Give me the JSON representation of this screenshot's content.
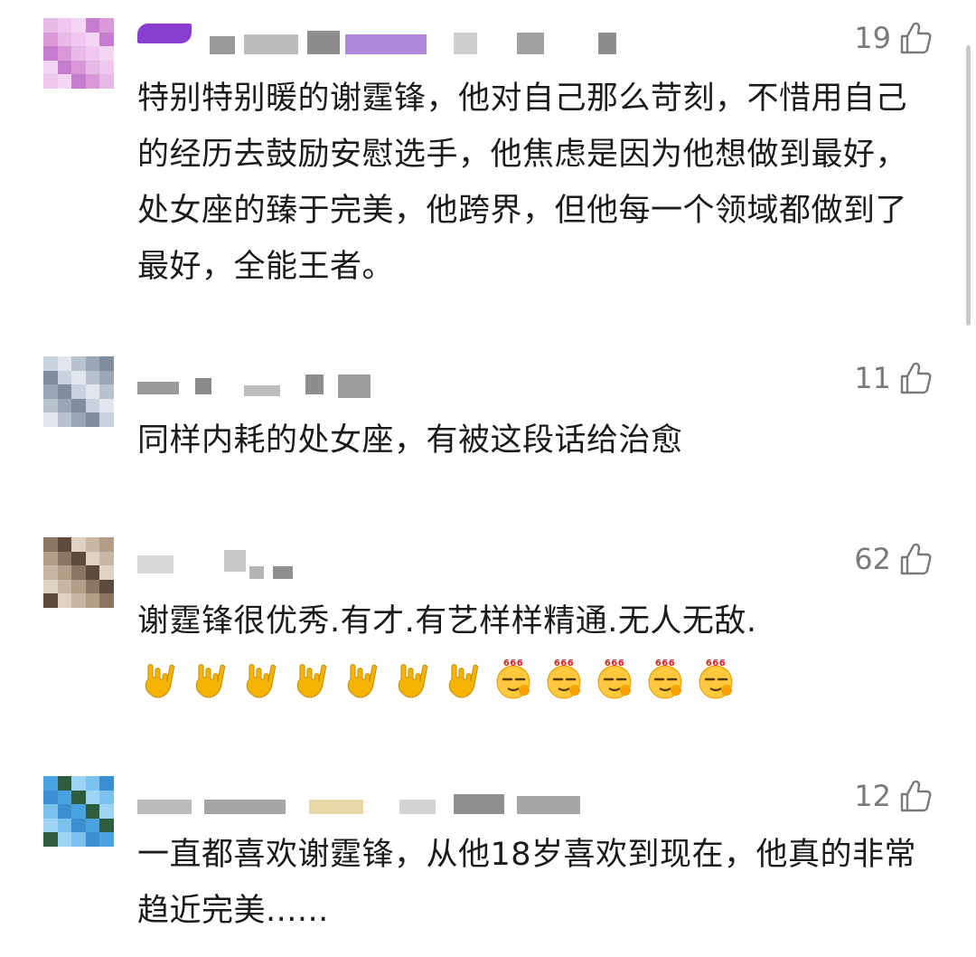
{
  "comments": [
    {
      "likes": "19",
      "text": "特别特别暖的谢霆锋，他对自己那么苛刻，不惜用自己的经历去鼓励安慰选手，他焦虑是因为他想做到最好，处女座的臻于完美，他跨界，但他每一个领域都做到了最好，全能王者。",
      "avatar_colors": [
        "#e7b9e6",
        "#c77dcf",
        "#efc7ef",
        "#d998d8",
        "#f3d6f2"
      ]
    },
    {
      "likes": "11",
      "text": "同样内耗的处女座，有被这段话给治愈",
      "avatar_colors": [
        "#c9d3de",
        "#9aa7b5",
        "#e1e6ec",
        "#7f8d9d",
        "#b8c2cd"
      ]
    },
    {
      "likes": "62",
      "text": "谢霆锋很优秀.有才.有艺样样精通.无人无敌.",
      "emojis": [
        "rock-hand-icon",
        "rock-hand-icon",
        "rock-hand-icon",
        "rock-hand-icon",
        "rock-hand-icon",
        "rock-hand-icon",
        "rock-hand-icon",
        "666-smug-face-icon",
        "666-smug-face-icon",
        "666-smug-face-icon",
        "666-smug-face-icon",
        "666-smug-face-icon"
      ],
      "emoji_badge": "666",
      "avatar_colors": [
        "#8b7563",
        "#c9b7a6",
        "#5e4a3d",
        "#b39c88",
        "#e0d3c6"
      ]
    },
    {
      "likes": "12",
      "text": "一直都喜欢谢霆锋，从他18岁喜欢到现在，他真的非常趋近完美......",
      "avatar_colors": [
        "#4aa3e0",
        "#7cc2ef",
        "#2e5d3d",
        "#3b8fd1",
        "#9fd3f5"
      ]
    }
  ],
  "colors": {
    "like_gray": "#7a7a7a",
    "text": "#1b1b1b",
    "rock_hand": "#f5b400"
  }
}
